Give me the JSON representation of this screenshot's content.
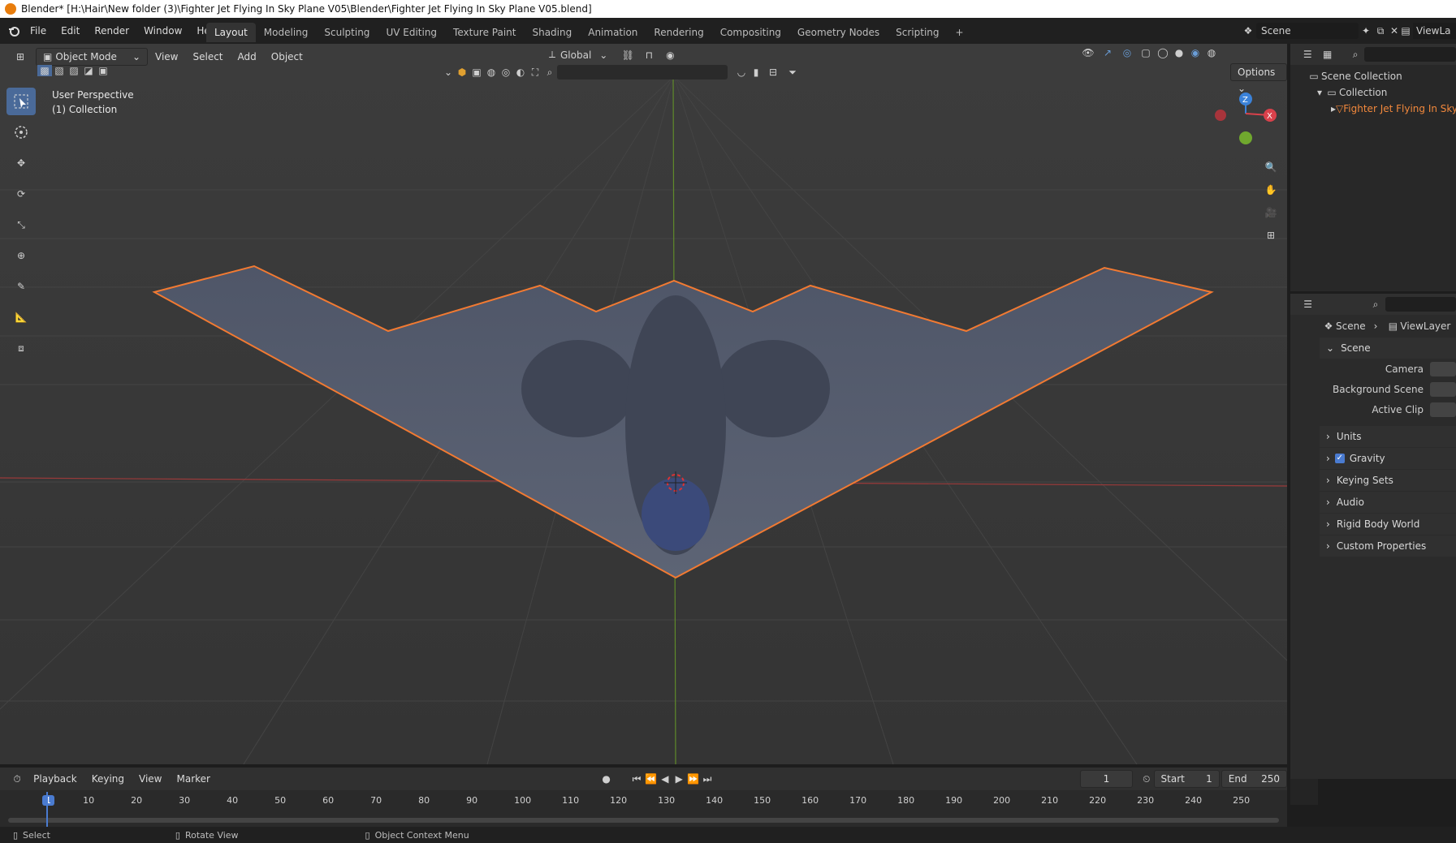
{
  "title": "Blender* [H:\\Hair\\New folder (3)\\Fighter Jet Flying In Sky Plane V05\\Blender\\Fighter Jet Flying In Sky Plane V05.blend]",
  "menus": [
    "File",
    "Edit",
    "Render",
    "Window",
    "Help"
  ],
  "workspaces": [
    "Layout",
    "Modeling",
    "Sculpting",
    "UV Editing",
    "Texture Paint",
    "Shading",
    "Animation",
    "Rendering",
    "Compositing",
    "Geometry Nodes",
    "Scripting"
  ],
  "active_workspace": "Layout",
  "scene_field": "Scene",
  "viewlayer_field": "ViewLa",
  "viewport": {
    "mode": "Object Mode",
    "header_menus": [
      "View",
      "Select",
      "Add",
      "Object"
    ],
    "transform_orientation": "Global",
    "options_label": "Options",
    "overlay_line1": "User Perspective",
    "overlay_line2": "(1) Collection",
    "gizmo_axes": [
      "Z",
      "X"
    ]
  },
  "outliner": {
    "root": "Scene Collection",
    "collection": "Collection",
    "object": "Fighter Jet Flying In Sky"
  },
  "properties": {
    "breadcrumb_scene": "Scene",
    "breadcrumb_layer": "ViewLayer",
    "panel_title": "Scene",
    "fields": [
      {
        "label": "Camera"
      },
      {
        "label": "Background Scene"
      },
      {
        "label": "Active Clip"
      }
    ],
    "sections": [
      "Units",
      "Gravity",
      "Keying Sets",
      "Audio",
      "Rigid Body World",
      "Custom Properties"
    ],
    "gravity_checked": true
  },
  "timeline": {
    "menus": [
      "Playback",
      "Keying",
      "View",
      "Marker"
    ],
    "current_frame": "1",
    "start_label": "Start",
    "start_value": "1",
    "end_label": "End",
    "end_value": "250",
    "ruler": [
      "1",
      "10",
      "20",
      "30",
      "40",
      "50",
      "60",
      "70",
      "80",
      "90",
      "100",
      "110",
      "120",
      "130",
      "140",
      "150",
      "160",
      "170",
      "180",
      "190",
      "200",
      "210",
      "220",
      "230",
      "240",
      "250"
    ]
  },
  "status": [
    "Select",
    "Rotate View",
    "Object Context Menu"
  ]
}
